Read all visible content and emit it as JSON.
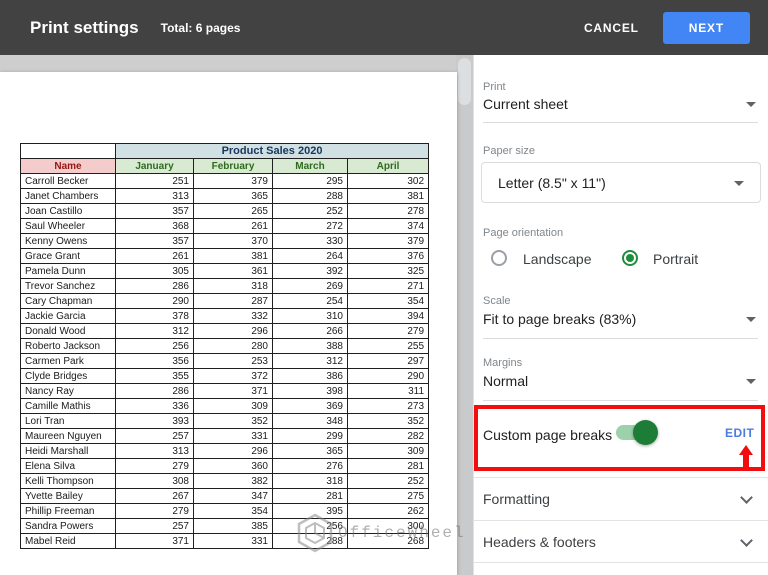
{
  "header": {
    "title": "Print settings",
    "total": "Total: 6 pages",
    "cancel_label": "CANCEL",
    "next_label": "NEXT"
  },
  "panel": {
    "print": {
      "label": "Print",
      "value": "Current sheet"
    },
    "paper_size": {
      "label": "Paper size",
      "value": "Letter (8.5\" x 11\")"
    },
    "orientation": {
      "label": "Page orientation",
      "options": [
        {
          "label": "Landscape",
          "selected": false
        },
        {
          "label": "Portrait",
          "selected": true
        }
      ]
    },
    "scale": {
      "label": "Scale",
      "value": "Fit to page breaks (83%)"
    },
    "margins": {
      "label": "Margins",
      "value": "Normal"
    },
    "custom_page_breaks": {
      "label": "Custom page breaks",
      "enabled": true,
      "edit_label": "EDIT"
    },
    "sections": [
      {
        "label": "Formatting"
      },
      {
        "label": "Headers & footers"
      }
    ]
  },
  "sheet": {
    "title": "Product Sales 2020",
    "columns": [
      "Name",
      "January",
      "February",
      "March",
      "April"
    ],
    "rows": [
      [
        "Carroll Becker",
        "251",
        "379",
        "295",
        "302"
      ],
      [
        "Janet Chambers",
        "313",
        "365",
        "288",
        "381"
      ],
      [
        "Joan Castillo",
        "357",
        "265",
        "252",
        "278"
      ],
      [
        "Saul Wheeler",
        "368",
        "261",
        "272",
        "374"
      ],
      [
        "Kenny Owens",
        "357",
        "370",
        "330",
        "379"
      ],
      [
        "Grace Grant",
        "261",
        "381",
        "264",
        "376"
      ],
      [
        "Pamela Dunn",
        "305",
        "361",
        "392",
        "325"
      ],
      [
        "Trevor Sanchez",
        "286",
        "318",
        "269",
        "271"
      ],
      [
        "Cary Chapman",
        "290",
        "287",
        "254",
        "354"
      ],
      [
        "Jackie Garcia",
        "378",
        "332",
        "310",
        "394"
      ],
      [
        "Donald Wood",
        "312",
        "296",
        "266",
        "279"
      ],
      [
        "Roberto Jackson",
        "256",
        "280",
        "388",
        "255"
      ],
      [
        "Carmen Park",
        "356",
        "253",
        "312",
        "297"
      ],
      [
        "Clyde Bridges",
        "355",
        "372",
        "386",
        "290"
      ],
      [
        "Nancy Ray",
        "286",
        "371",
        "398",
        "311"
      ],
      [
        "Camille Mathis",
        "336",
        "309",
        "369",
        "273"
      ],
      [
        "Lori Tran",
        "393",
        "352",
        "348",
        "352"
      ],
      [
        "Maureen Nguyen",
        "257",
        "331",
        "299",
        "282"
      ],
      [
        "Heidi Marshall",
        "313",
        "296",
        "365",
        "309"
      ],
      [
        "Elena Silva",
        "279",
        "360",
        "276",
        "281"
      ],
      [
        "Kelli Thompson",
        "308",
        "382",
        "318",
        "252"
      ],
      [
        "Yvette Bailey",
        "267",
        "347",
        "281",
        "275"
      ],
      [
        "Phillip Freeman",
        "279",
        "354",
        "395",
        "262"
      ],
      [
        "Sandra Powers",
        "257",
        "385",
        "256",
        "300"
      ],
      [
        "Mabel Reid",
        "371",
        "331",
        "288",
        "268"
      ]
    ]
  },
  "watermark": {
    "text": "OfficeWheel"
  },
  "colors": {
    "header_bg": "#424242",
    "next_button": "#4285f4",
    "accent_green": "#1e8e3e",
    "highlight_red": "#f10e0e",
    "edit_blue": "#4c7ce0",
    "title_cell_bg": "#d0e0e3",
    "name_header_bg": "#f4cccc",
    "month_header_bg": "#d9ead3"
  }
}
